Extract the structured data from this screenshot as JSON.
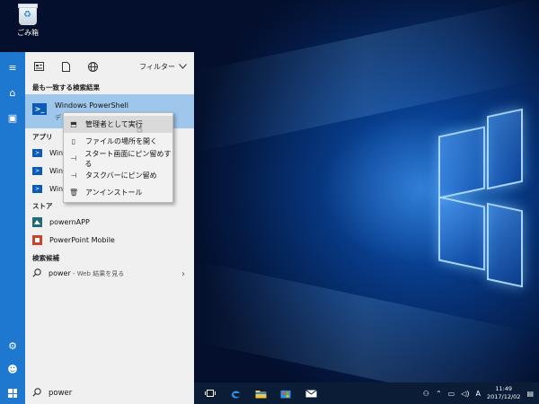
{
  "desktop": {
    "recycle_bin_label": "ごみ箱"
  },
  "start_menu": {
    "toolbar": {
      "filter_label": "フィルター"
    },
    "best_match": {
      "header": "最も一致する検索結果",
      "title": "Windows PowerShell",
      "subtitle": "デ"
    },
    "apps": {
      "header": "アプリ",
      "items": [
        "Winc",
        "Wind",
        "Wind"
      ]
    },
    "store": {
      "header": "ストア",
      "items": [
        "powernAPP",
        "PowerPoint Mobile"
      ]
    },
    "suggestions": {
      "header": "検索候補",
      "query": "power",
      "hint": " - Web 結果を見る"
    }
  },
  "context_menu": {
    "items": [
      {
        "label": "管理者として実行",
        "icon": "shield-run-icon"
      },
      {
        "label": "ファイルの場所を開く",
        "icon": "folder-icon"
      },
      {
        "label": "スタート画面にピン留めする",
        "icon": "pin-icon"
      },
      {
        "label": "タスクバーにピン留め",
        "icon": "pin-icon"
      },
      {
        "label": "アンインストール",
        "icon": "trash-icon"
      }
    ]
  },
  "taskbar": {
    "search_text": "power",
    "clock_time": "11:49",
    "clock_date": "2017/12/02",
    "ime_label": "A"
  }
}
